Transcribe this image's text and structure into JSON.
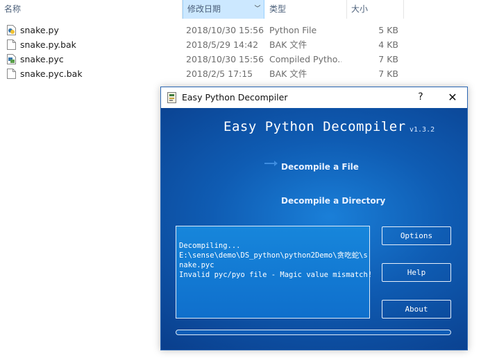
{
  "explorer": {
    "columns": {
      "name": "名称",
      "date": "修改日期",
      "type": "类型",
      "size": "大小"
    },
    "files": [
      {
        "name": "snake.py",
        "date": "2018/10/30 15:56",
        "type": "Python File",
        "size": "5 KB",
        "icon": "python-file-icon"
      },
      {
        "name": "snake.py.bak",
        "date": "2018/5/29 14:42",
        "type": "BAK 文件",
        "size": "4 KB",
        "icon": "generic-file-icon"
      },
      {
        "name": "snake.pyc",
        "date": "2018/10/30 15:56",
        "type": "Compiled Pytho...",
        "size": "7 KB",
        "icon": "compiled-python-icon"
      },
      {
        "name": "snake.pyc.bak",
        "date": "2018/2/5 17:15",
        "type": "BAK 文件",
        "size": "7 KB",
        "icon": "generic-file-icon"
      }
    ]
  },
  "dialog": {
    "window_title": "Easy Python Decompiler",
    "help_glyph": "?",
    "close_glyph": "✕",
    "app_title": "Easy Python Decompiler",
    "version": "v1.3.2",
    "decompile_file": "Decompile a File",
    "decompile_dir": "Decompile a Directory",
    "log_lines": [
      "Decompiling...",
      "E:\\sense\\demo\\DS_python\\python2Demo\\贪吃蛇\\s",
      "nake.pyc",
      "Invalid pyc/pyo file - Magic value mismatch!"
    ],
    "buttons": {
      "options": "Options",
      "help": "Help",
      "about": "About"
    },
    "progress_fraction": 0
  }
}
